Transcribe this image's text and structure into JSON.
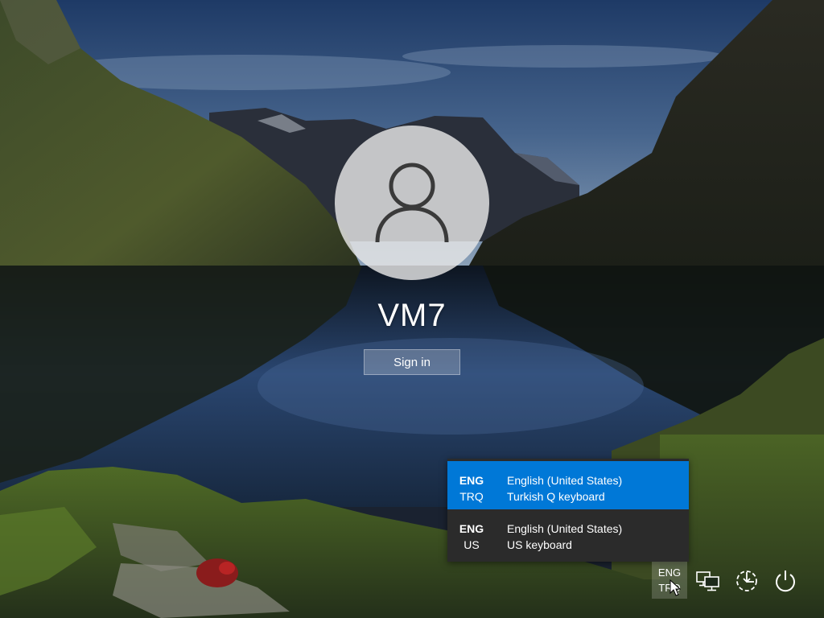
{
  "user": {
    "name": "VM7",
    "signin_label": "Sign in"
  },
  "language_menu": {
    "items": [
      {
        "lang_code": "ENG",
        "layout_code": "TRQ",
        "language": "English (United States)",
        "layout": "Turkish Q keyboard",
        "selected": true
      },
      {
        "lang_code": "ENG",
        "layout_code": "US",
        "language": "English (United States)",
        "layout": "US keyboard",
        "selected": false
      }
    ]
  },
  "tray": {
    "lang_code": "ENG",
    "layout_code": "TRQ",
    "network_icon": "network-icon",
    "ease_of_access_icon": "ease-of-access-icon",
    "power_icon": "power-icon"
  },
  "colors": {
    "accent": "#0078d7",
    "menu_bg": "#2b2b2b"
  }
}
